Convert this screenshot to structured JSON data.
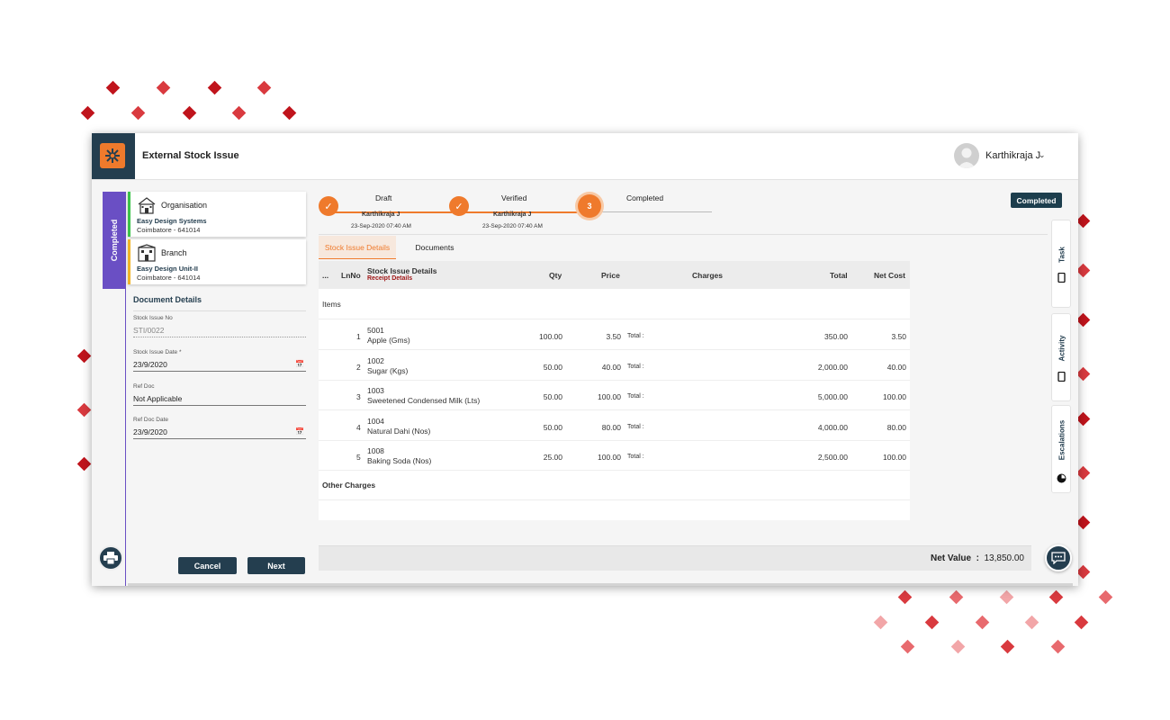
{
  "app": {
    "title": "External Stock Issue"
  },
  "user": {
    "name": "Karthikraja J"
  },
  "status": {
    "strip_label": "Completed",
    "badge": "Completed"
  },
  "organisation": {
    "title": "Organisation",
    "name": "Easy Design Systems",
    "address": "Coimbatore - 641014"
  },
  "branch": {
    "title": "Branch",
    "name": "Easy Design Unit-II",
    "address": "Coimbatore - 641014"
  },
  "document": {
    "heading": "Document Details",
    "fields": [
      {
        "label": "Stock Issue No",
        "value": "STI/0022"
      },
      {
        "label": "Stock Issue Date *",
        "value": "23/9/2020"
      },
      {
        "label": "Ref Doc",
        "value": "Not Applicable"
      },
      {
        "label": "Ref Doc Date",
        "value": "23/9/2020"
      }
    ]
  },
  "buttons": {
    "cancel": "Cancel",
    "next": "Next"
  },
  "stepper": [
    {
      "label": "Draft",
      "user": "Karthikraja J",
      "date": "23-Sep-2020 07:40 AM",
      "state": "done",
      "mark": "✓"
    },
    {
      "label": "Verified",
      "user": "Karthikraja J",
      "date": "23-Sep-2020 07:40 AM",
      "state": "done",
      "mark": "✓"
    },
    {
      "label": "Completed",
      "user": "",
      "date": "",
      "state": "current",
      "mark": "3"
    }
  ],
  "tabs": [
    {
      "label": "Stock Issue Details",
      "active": true
    },
    {
      "label": "Documents",
      "active": false
    }
  ],
  "table": {
    "headers": {
      "menu": "...",
      "lnno": "LnNo",
      "details": "Stock Issue Details",
      "sub": "Receipt Details",
      "qty": "Qty",
      "price": "Price",
      "charges": "Charges",
      "total": "Total",
      "netcost": "Net Cost"
    },
    "items_label": "Items",
    "rows": [
      {
        "ln": "1",
        "code": "5001",
        "name": "Apple (Gms)",
        "qty": "100.00",
        "price": "3.50",
        "total_label": "Total :",
        "total": "350.00",
        "netcost": "3.50"
      },
      {
        "ln": "2",
        "code": "1002",
        "name": "Sugar (Kgs)",
        "qty": "50.00",
        "price": "40.00",
        "total_label": "Total :",
        "total": "2,000.00",
        "netcost": "40.00"
      },
      {
        "ln": "3",
        "code": "1003",
        "name": "Sweetened Condensed Milk (Lts)",
        "qty": "50.00",
        "price": "100.00",
        "total_label": "Total :",
        "total": "5,000.00",
        "netcost": "100.00"
      },
      {
        "ln": "4",
        "code": "1004",
        "name": "Natural Dahi (Nos)",
        "qty": "50.00",
        "price": "80.00",
        "total_label": "Total :",
        "total": "4,000.00",
        "netcost": "80.00"
      },
      {
        "ln": "5",
        "code": "1008",
        "name": "Baking Soda (Nos)",
        "qty": "25.00",
        "price": "100.00",
        "total_label": "Total :",
        "total": "2,500.00",
        "netcost": "100.00"
      }
    ],
    "other_charges_label": "Other Charges"
  },
  "net_value": {
    "label": "Net Value",
    "separator": ":",
    "value": "13,850.00"
  },
  "side_tabs": [
    {
      "label": "Task",
      "icon": "tablet-icon"
    },
    {
      "label": "Activity",
      "icon": "tablet-icon"
    },
    {
      "label": "Escalations",
      "icon": "pie-icon"
    }
  ],
  "colors": {
    "accent": "#ef7a2c",
    "navy": "#243e4f",
    "status_purple": "#6a4fc4"
  }
}
